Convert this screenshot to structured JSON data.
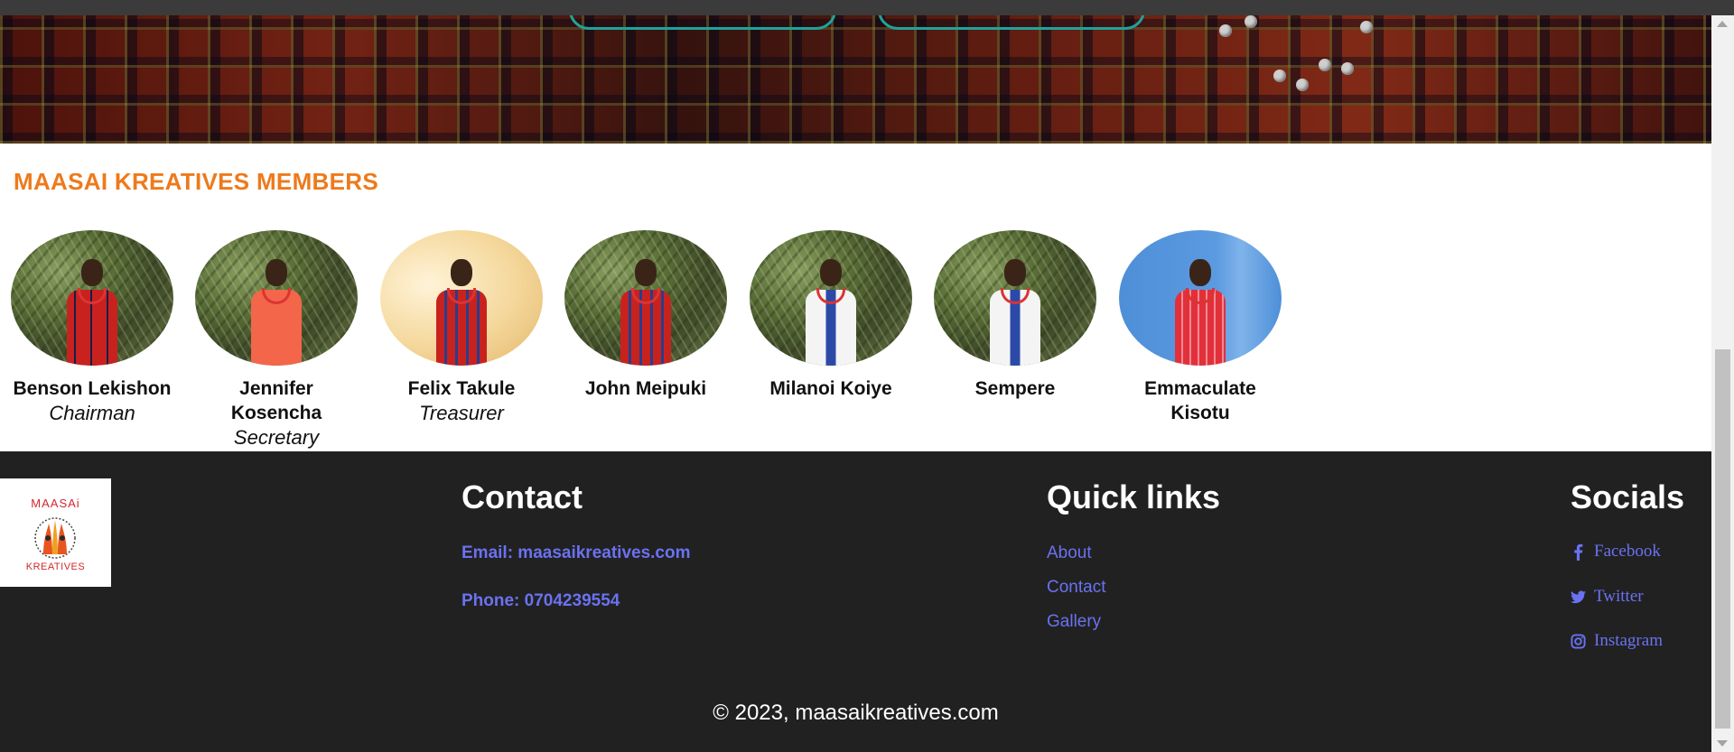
{
  "members_section": {
    "title": "MAASAI KREATIVES MEMBERS",
    "members": [
      {
        "name": "Benson Lekishon",
        "role": "Chairman"
      },
      {
        "name": "Jennifer Kosencha",
        "role": "Secretary"
      },
      {
        "name": "Felix Takule",
        "role": "Treasurer"
      },
      {
        "name": "John Meipuki",
        "role": ""
      },
      {
        "name": "Milanoi Koiye",
        "role": ""
      },
      {
        "name": "Sempere",
        "role": ""
      },
      {
        "name": "Emmaculate Kisotu",
        "role": ""
      }
    ]
  },
  "footer": {
    "logo": {
      "top_text": "MAASAi",
      "bottom_text": "KREATIVES"
    },
    "contact": {
      "title": "Contact",
      "email": "Email: maasaikreatives.com",
      "phone": "Phone: 0704239554"
    },
    "quick_links": {
      "title": "Quick links",
      "items": [
        "About",
        "Contact",
        "Gallery"
      ]
    },
    "socials": {
      "title": "Socials",
      "items": [
        {
          "label": "Facebook",
          "icon": "facebook-icon"
        },
        {
          "label": "Twitter",
          "icon": "twitter-icon"
        },
        {
          "label": "Instagram",
          "icon": "instagram-icon"
        }
      ]
    },
    "copyright": "© 2023, maasaikreatives.com"
  },
  "colors": {
    "accent_orange": "#ee7a1b",
    "link_blue": "#6a72f1",
    "footer_bg": "#212121",
    "button_teal": "#1fa39a"
  }
}
